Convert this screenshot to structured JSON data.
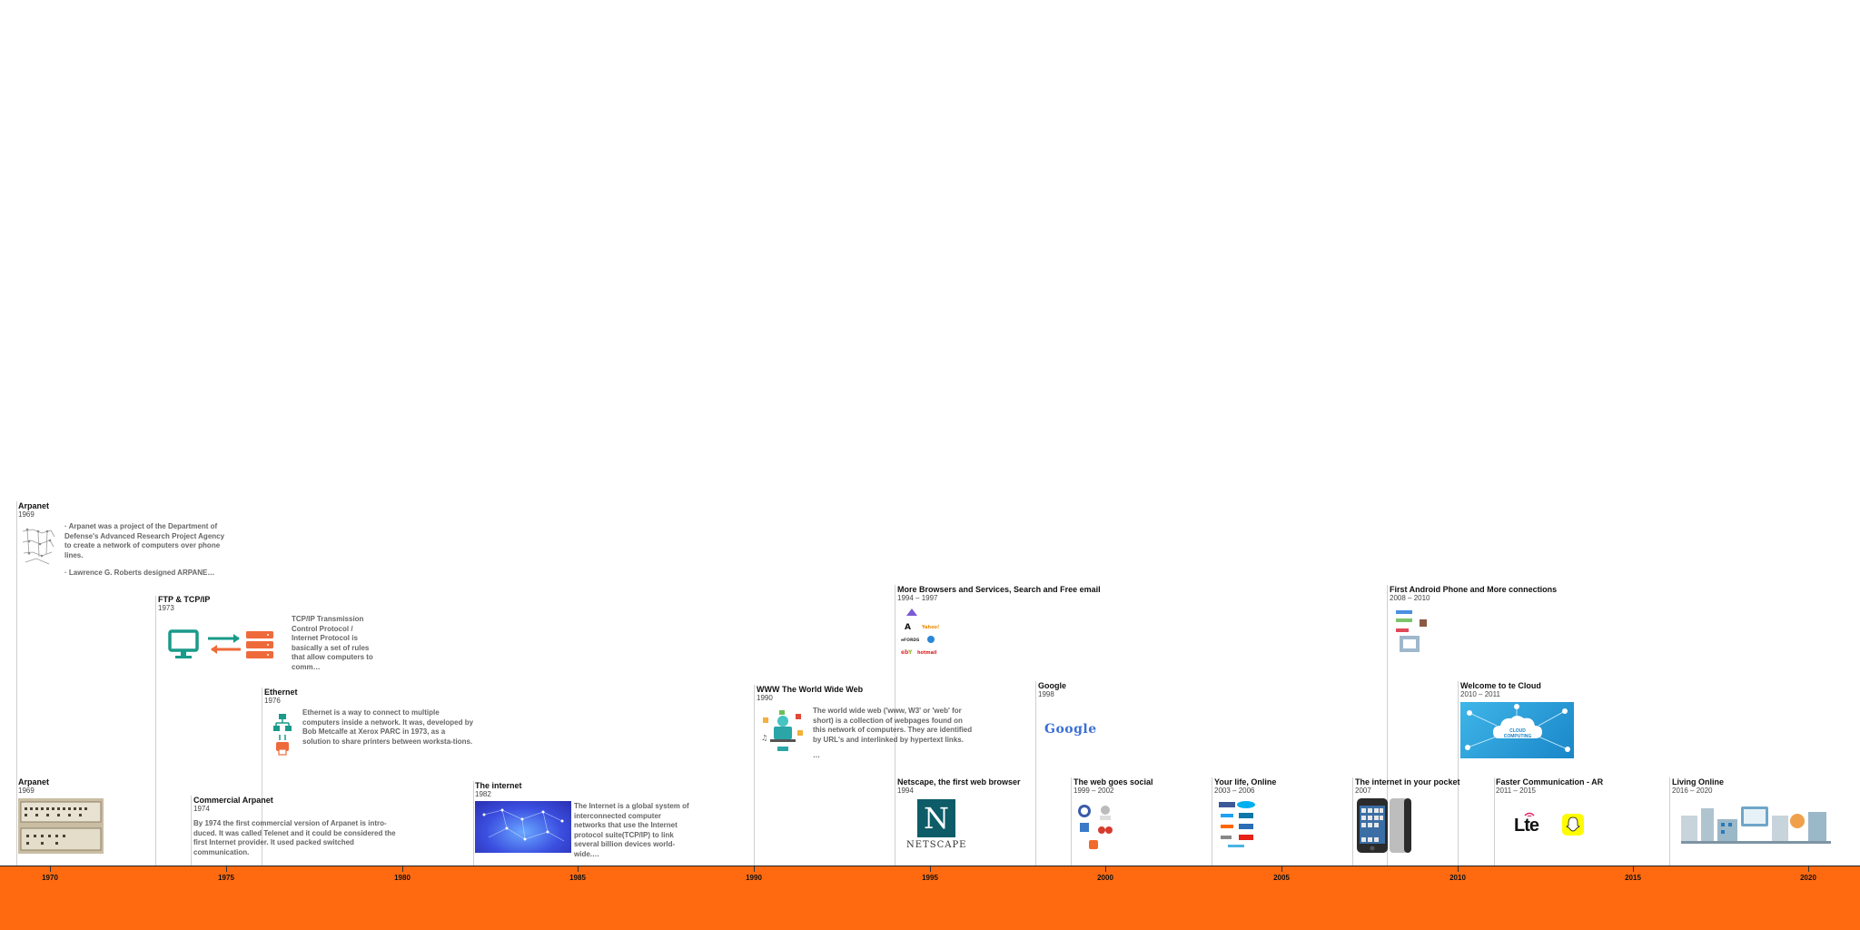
{
  "events": {
    "arpanet_top": {
      "title": "Arpanet",
      "date": "1969",
      "text1": "· Arpanet was a project of the Department of Defense's Advanced Research Project Agency to create a network of computers over phone lines.",
      "text2": "· Lawrence G. Roberts designed ARPANE…"
    },
    "ftp": {
      "title": "FTP & TCP/IP",
      "date": "1973",
      "text": "TCP/IP Transmission Control Protocol / Internet Protocol is basically a set of rules that allow computers to comm…"
    },
    "ethernet": {
      "title": "Ethernet",
      "date": "1976",
      "text": "Ethernet is a way to connect to multiple computers inside a network. It was, developed by Bob Metcalfe at Xerox PARC in 1973, as a solution to share printers between worksta-tions."
    },
    "arpanet_bottom": {
      "title": "Arpanet",
      "date": "1969"
    },
    "commercial": {
      "title": "Commercial Arpanet",
      "date": "1974",
      "text": "By 1974 the first commercial version of Arpanet is intro-duced. It was called Telenet and it could be considered the first Internet provider. It used packed switched communication."
    },
    "internet": {
      "title": "The internet",
      "date": "1982",
      "text": "The Internet is a global system of interconnected computer networks that use the Internet protocol suite(TCP/IP) to link several billion devices world-wide.…"
    },
    "www": {
      "title": "WWW The World Wide Web",
      "date": "1990",
      "text": "The world wide web ('www, W3' or 'web' for short) is a collection of webpages found on this network of computers. They are identified by URL's and interlinked by hypertext links.",
      "more": "…"
    },
    "browsers": {
      "title": "More Browsers and Services, Search and Free email",
      "date": "1994 – 1997"
    },
    "netscape": {
      "title": "Netscape, the first web browser",
      "date": "1994",
      "logo_text": "NETSCAPE",
      "logo_letter": "N"
    },
    "google": {
      "title": "Google",
      "date": "1998",
      "logo_text": "Google"
    },
    "social": {
      "title": "The web goes social",
      "date": "1999 – 2002"
    },
    "yourlife": {
      "title": "Your life, Online",
      "date": "2003 – 2006"
    },
    "pocket": {
      "title": "The internet in your pocket",
      "date": "2007"
    },
    "android": {
      "title": "First Android Phone and More connections",
      "date": "2008 – 2010"
    },
    "cloud": {
      "title": "Welcome to te Cloud",
      "date": "2010 – 2011",
      "badge": "CLOUD COMPUTING"
    },
    "faster": {
      "title": "Faster Communication - AR",
      "date": "2011 – 2015",
      "lte": "Lte"
    },
    "living": {
      "title": "Living Online",
      "date": "2016 – 2020"
    }
  },
  "axis": {
    "labels": [
      "1970",
      "1975",
      "1980",
      "1985",
      "1990",
      "1995",
      "2000",
      "2005",
      "2010",
      "2015",
      "2020"
    ]
  },
  "colors": {
    "axis": "#ff6a10",
    "teal": "#1a9a8a",
    "orange": "#ef6a3a"
  }
}
